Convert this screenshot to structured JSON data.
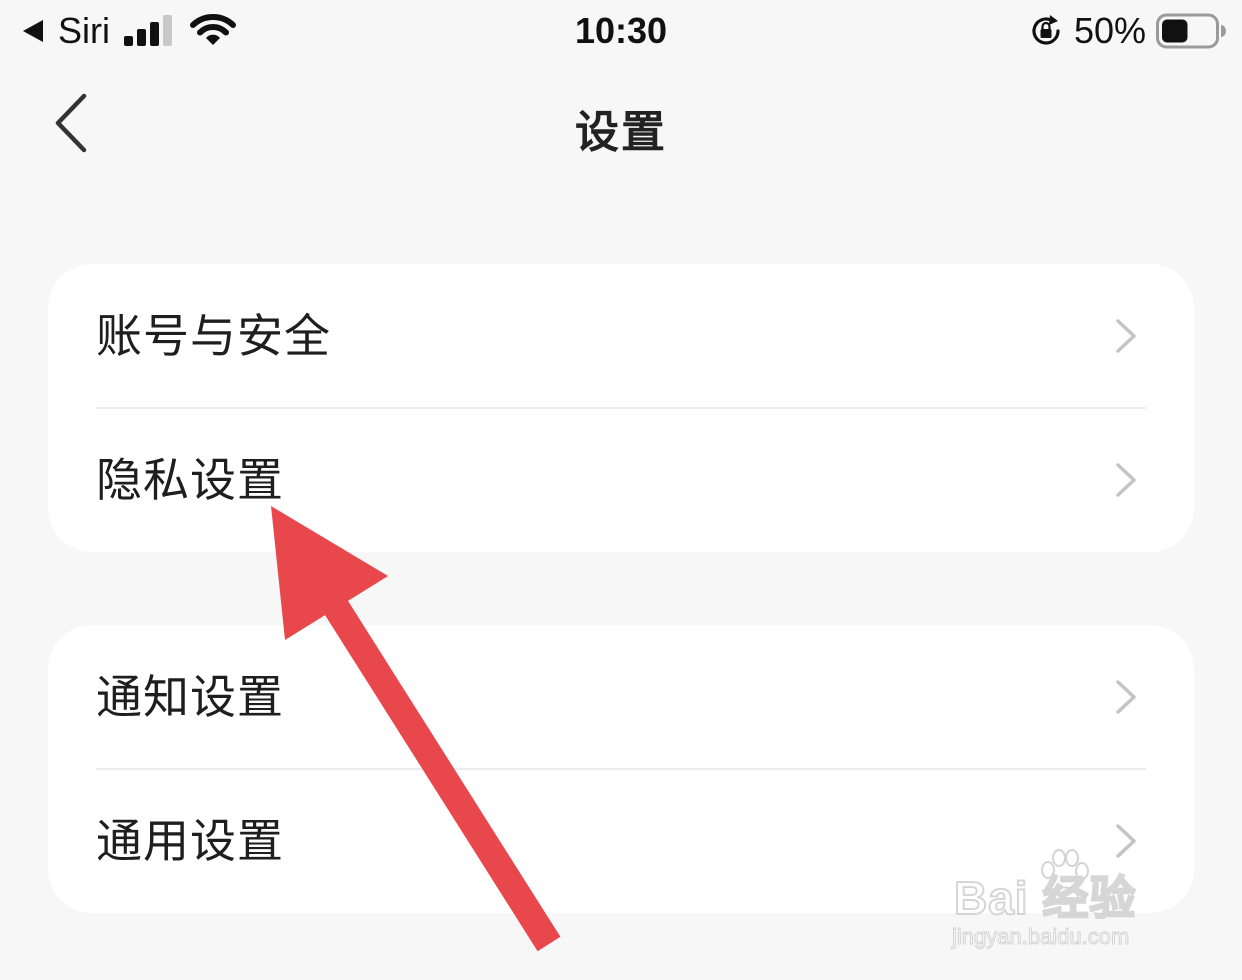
{
  "status_bar": {
    "back_app": "Siri",
    "time": "10:30",
    "battery_percent": "50%",
    "battery_level": 0.5,
    "signal_bars_filled": 3,
    "signal_bars_total": 4,
    "icons": [
      "back-triangle-icon",
      "signal-icon",
      "wifi-icon",
      "rotation-lock-icon",
      "battery-icon"
    ]
  },
  "nav": {
    "title": "设置",
    "back_icon": "chevron-left-icon"
  },
  "groups": [
    {
      "items": [
        {
          "label": "账号与安全",
          "icon": "chevron-right-icon"
        },
        {
          "label": "隐私设置",
          "icon": "chevron-right-icon"
        }
      ]
    },
    {
      "items": [
        {
          "label": "通知设置",
          "icon": "chevron-right-icon"
        },
        {
          "label": "通用设置",
          "icon": "chevron-right-icon"
        }
      ]
    }
  ],
  "annotation": {
    "type": "arrow",
    "color": "#e8474c",
    "points_to": "隐私设置"
  },
  "watermark": {
    "brand": "Bai  经验",
    "url": "jingyan.baidu.com"
  },
  "colors": {
    "background": "#f7f7f7",
    "card": "#ffffff",
    "chevron": "#c4c4c4",
    "arrow": "#e8474c"
  }
}
